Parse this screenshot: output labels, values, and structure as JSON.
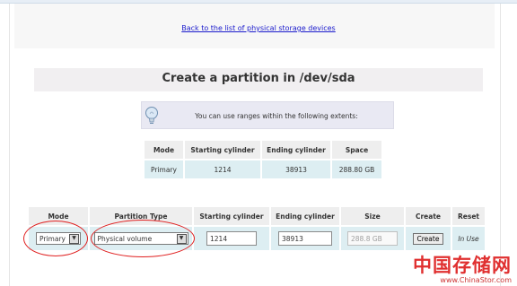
{
  "back_link": "Back to the list of physical storage devices",
  "page_title": "Create a partition in /dev/sda",
  "info_message": "You can use ranges within the following extents:",
  "extents": {
    "headers": [
      "Mode",
      "Starting cylinder",
      "Ending cylinder",
      "Space"
    ],
    "row": [
      "Primary",
      "1214",
      "38913",
      "288.80 GB"
    ]
  },
  "form": {
    "headers": [
      "Mode",
      "Partition Type",
      "Starting cylinder",
      "Ending cylinder",
      "Size",
      "Create",
      "Reset"
    ],
    "mode_selected": "Primary",
    "partition_type_selected": "Physical volume",
    "starting_cylinder": "1214",
    "ending_cylinder": "38913",
    "size": "288.8 GB",
    "create_button": "Create",
    "reset_text": "In Use"
  },
  "watermark": {
    "brand": "中国存储网",
    "url": "www.ChinaStor.com"
  },
  "colors": {
    "link": "#1a1acc",
    "header_bg": "#eeeeee",
    "cell_bg": "#ddeef2",
    "annotation_red": "#e02020"
  },
  "icons": {
    "info": "lightbulb-icon",
    "dropdown": "dropdown-arrow-icon"
  }
}
